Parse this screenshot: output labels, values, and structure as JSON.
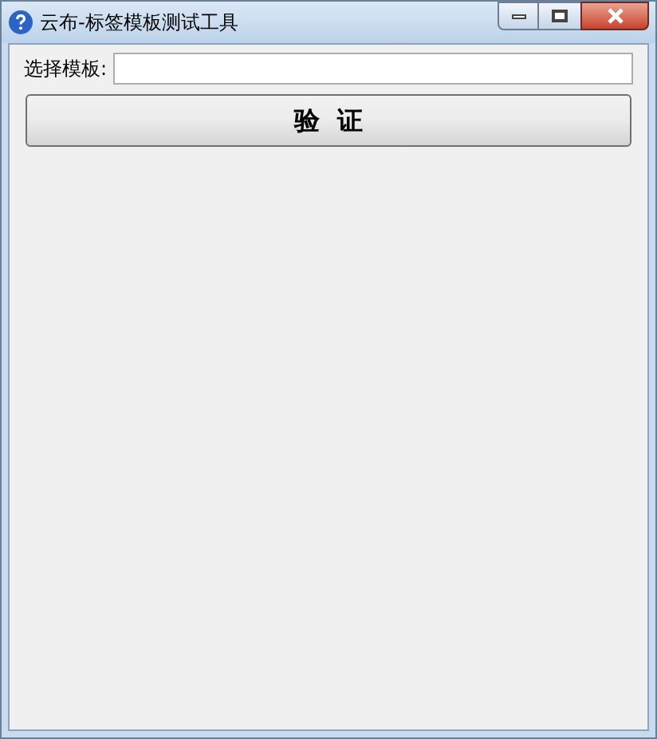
{
  "window": {
    "title": "云布-标签模板测试工具"
  },
  "template_field": {
    "label": "选择模板:"
  },
  "verify_button": {
    "label": "验  证"
  }
}
